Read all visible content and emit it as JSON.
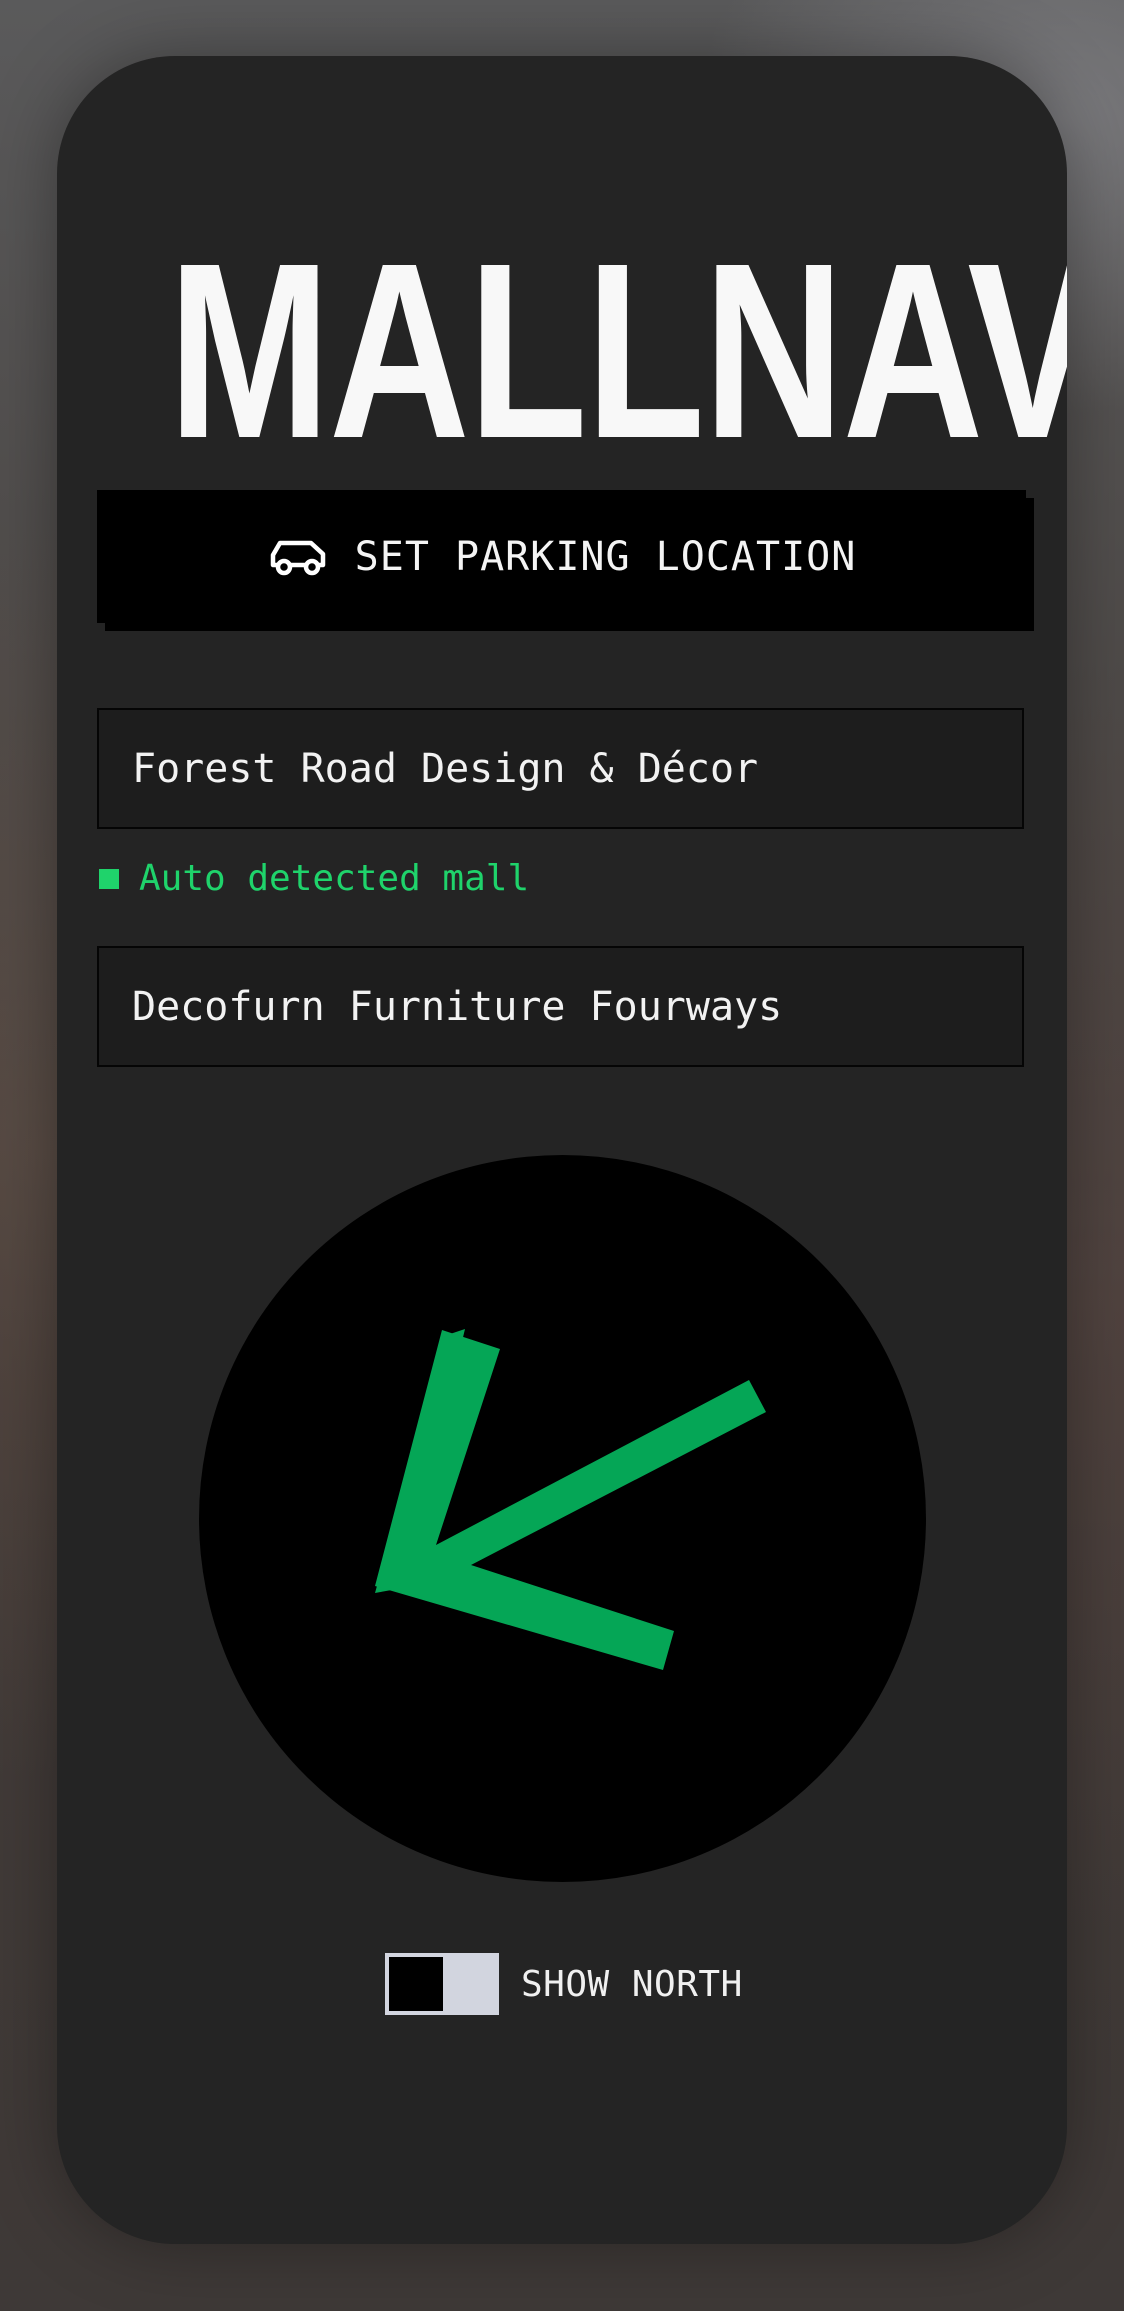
{
  "app": {
    "title": "MALLNAV"
  },
  "parking_button": {
    "label": "SET PARKING LOCATION",
    "icon": "car-icon"
  },
  "fields": {
    "origin_value": "Forest Road Design & Décor",
    "destination_value": "Decofurn Furniture Fourways"
  },
  "status": {
    "text": "Auto detected mall",
    "color": "#1fd36b"
  },
  "compass": {
    "arrow_color": "#05a656",
    "arrow_direction": "south-west",
    "icon": "direction-arrow-icon"
  },
  "toggle": {
    "label": "SHOW NORTH",
    "checked": false
  },
  "colors": {
    "card_bg": "#242424",
    "button_bg": "#000000",
    "accent_green": "#1fd36b"
  }
}
